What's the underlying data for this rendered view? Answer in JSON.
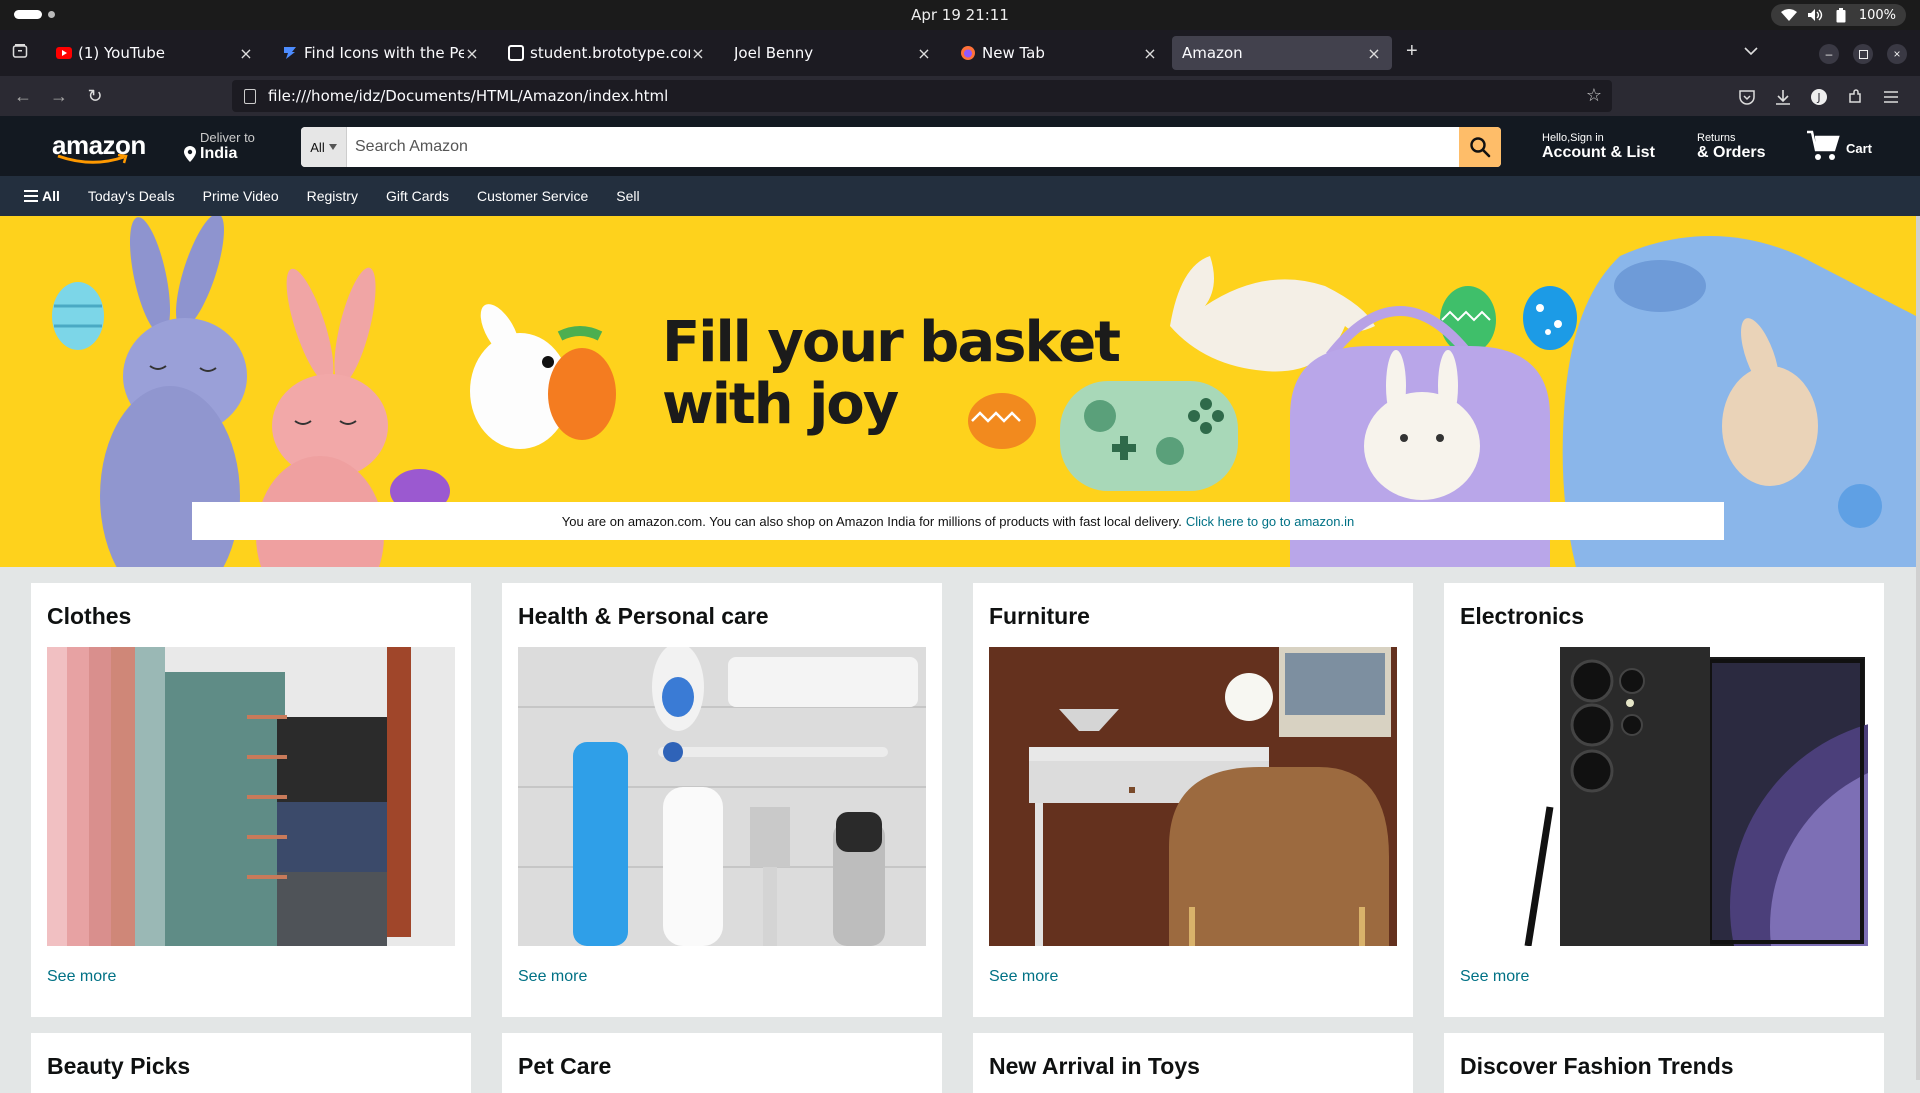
{
  "system": {
    "clock": "Apr 19  21:11",
    "battery": "100%"
  },
  "browser": {
    "tabs": [
      {
        "title": "(1) YouTube",
        "favicon": "youtube-icon",
        "active": false
      },
      {
        "title": "Find Icons with the Perfect",
        "favicon": "flaticon-icon",
        "active": false
      },
      {
        "title": "student.brototype.com/",
        "favicon": "brototype-icon",
        "active": false
      },
      {
        "title": "Joel Benny",
        "favicon": "none",
        "active": false
      },
      {
        "title": "New Tab",
        "favicon": "firefox-icon",
        "active": false
      },
      {
        "title": "Amazon",
        "favicon": "none",
        "active": true
      }
    ],
    "url": "file:///home/idz/Documents/HTML/Amazon/index.html"
  },
  "header": {
    "logo": "amazon",
    "deliver_small": "Deliver to",
    "deliver_big": "India",
    "search_category": "All",
    "search_placeholder": "Search Amazon",
    "account_small": "Hello,Sign in",
    "account_big": "Account & List",
    "returns_small": "Returns",
    "returns_big": "& Orders",
    "cart_label": "Cart"
  },
  "subnav": [
    "All",
    "Today's Deals",
    "Prime Video",
    "Registry",
    "Gift Cards",
    "Customer Service",
    "Sell"
  ],
  "hero": {
    "headline_line1": "Fill your basket",
    "headline_line2": "with joy",
    "notice_text": "You are on amazon.com. You can also shop on Amazon India for millions of products with fast local delivery.",
    "notice_link": "Click here to go to amazon.in"
  },
  "cards": [
    {
      "title": "Clothes",
      "link": "See more"
    },
    {
      "title": "Health & Personal care",
      "link": "See more"
    },
    {
      "title": "Furniture",
      "link": "See more"
    },
    {
      "title": "Electronics",
      "link": "See more"
    },
    {
      "title": "Beauty Picks"
    },
    {
      "title": "Pet Care"
    },
    {
      "title": "New Arrival in Toys"
    },
    {
      "title": "Discover Fashion Trends"
    }
  ],
  "colors": {
    "amazon_dark": "#131921",
    "amazon_nav": "#232f3e",
    "search_button": "#febd69",
    "hero_yellow": "#fed21c",
    "link_teal": "#007185"
  }
}
